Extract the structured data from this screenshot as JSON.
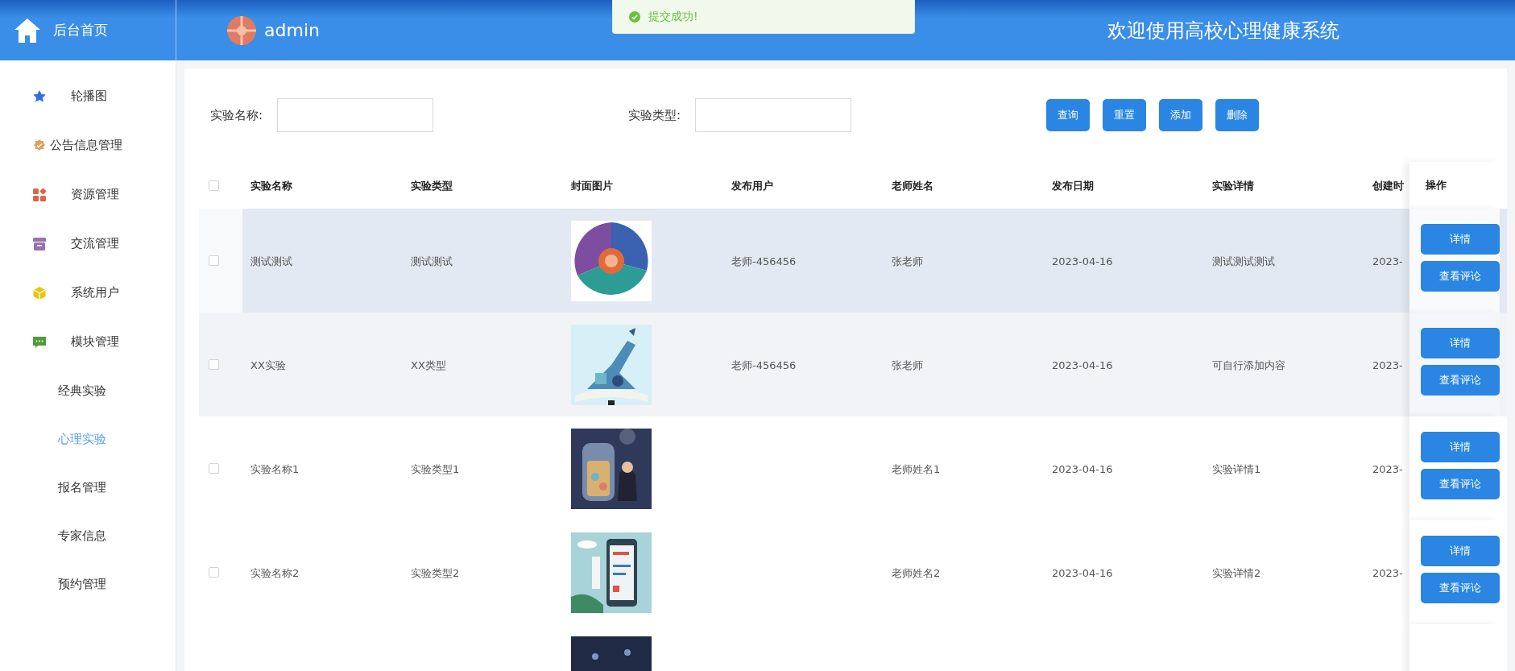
{
  "header": {
    "home_label": "后台首页",
    "user": "admin",
    "title": "欢迎使用高校心理健康系统"
  },
  "toast": {
    "message": "提交成功!"
  },
  "sidebar": {
    "items": [
      {
        "label": "轮播图",
        "selected": false
      },
      {
        "label": "公告信息管理",
        "selected": false
      },
      {
        "label": "资源管理",
        "selected": false
      },
      {
        "label": "交流管理",
        "selected": false
      },
      {
        "label": "系统用户",
        "selected": false
      },
      {
        "label": "模块管理",
        "selected": false,
        "children": [
          {
            "label": "经典实验",
            "selected": false
          },
          {
            "label": "心理实验",
            "selected": true
          },
          {
            "label": "报名管理",
            "selected": false
          },
          {
            "label": "专家信息",
            "selected": false
          },
          {
            "label": "预约管理",
            "selected": false
          }
        ]
      }
    ]
  },
  "search": {
    "fields": [
      {
        "label": "实验名称:"
      },
      {
        "label": "实验类型:"
      }
    ],
    "buttons": [
      "查询",
      "重置",
      "添加",
      "删除"
    ]
  },
  "table": {
    "select_all": {
      "checked": false
    },
    "columns": [
      "实验名称",
      "实验类型",
      "封面图片",
      "发布用户",
      "老师姓名",
      "发布日期",
      "实验详情",
      "创建时",
      "操作"
    ],
    "rows": [
      {
        "checked": false,
        "hovered": true,
        "cells": [
          "测试测试",
          "测试测试",
          {
            "kind": "picture"
          },
          "老师-456456",
          "张老师",
          "2023-04-16",
          "测试测试测试",
          "2023-"
        ],
        "actions": [
          "详情",
          "查看评论"
        ]
      },
      {
        "checked": false,
        "hovered": false,
        "cells": [
          "XX实验",
          "XX类型",
          {
            "kind": "picture"
          },
          "老师-456456",
          "张老师",
          "2023-04-16",
          "可自行添加内容",
          "2023-"
        ],
        "actions": [
          "详情",
          "查看评论"
        ]
      },
      {
        "checked": false,
        "hovered": false,
        "cells": [
          "实验名称1",
          "实验类型1",
          {
            "kind": "picture"
          },
          null,
          "老师姓名1",
          "2023-04-16",
          "实验详情1",
          "2023-"
        ],
        "actions": [
          "详情",
          "查看评论"
        ]
      },
      {
        "checked": false,
        "hovered": false,
        "cells": [
          "实验名称2",
          "实验类型2",
          {
            "kind": "picture"
          },
          null,
          "老师姓名2",
          "2023-04-16",
          "实验详情2",
          "2023-"
        ],
        "actions": [
          "详情",
          "查看评论"
        ]
      },
      {
        "cells": [
          null,
          null,
          {
            "kind": "picture"
          },
          null,
          null,
          null,
          null,
          null
        ],
        "actions": []
      }
    ]
  }
}
